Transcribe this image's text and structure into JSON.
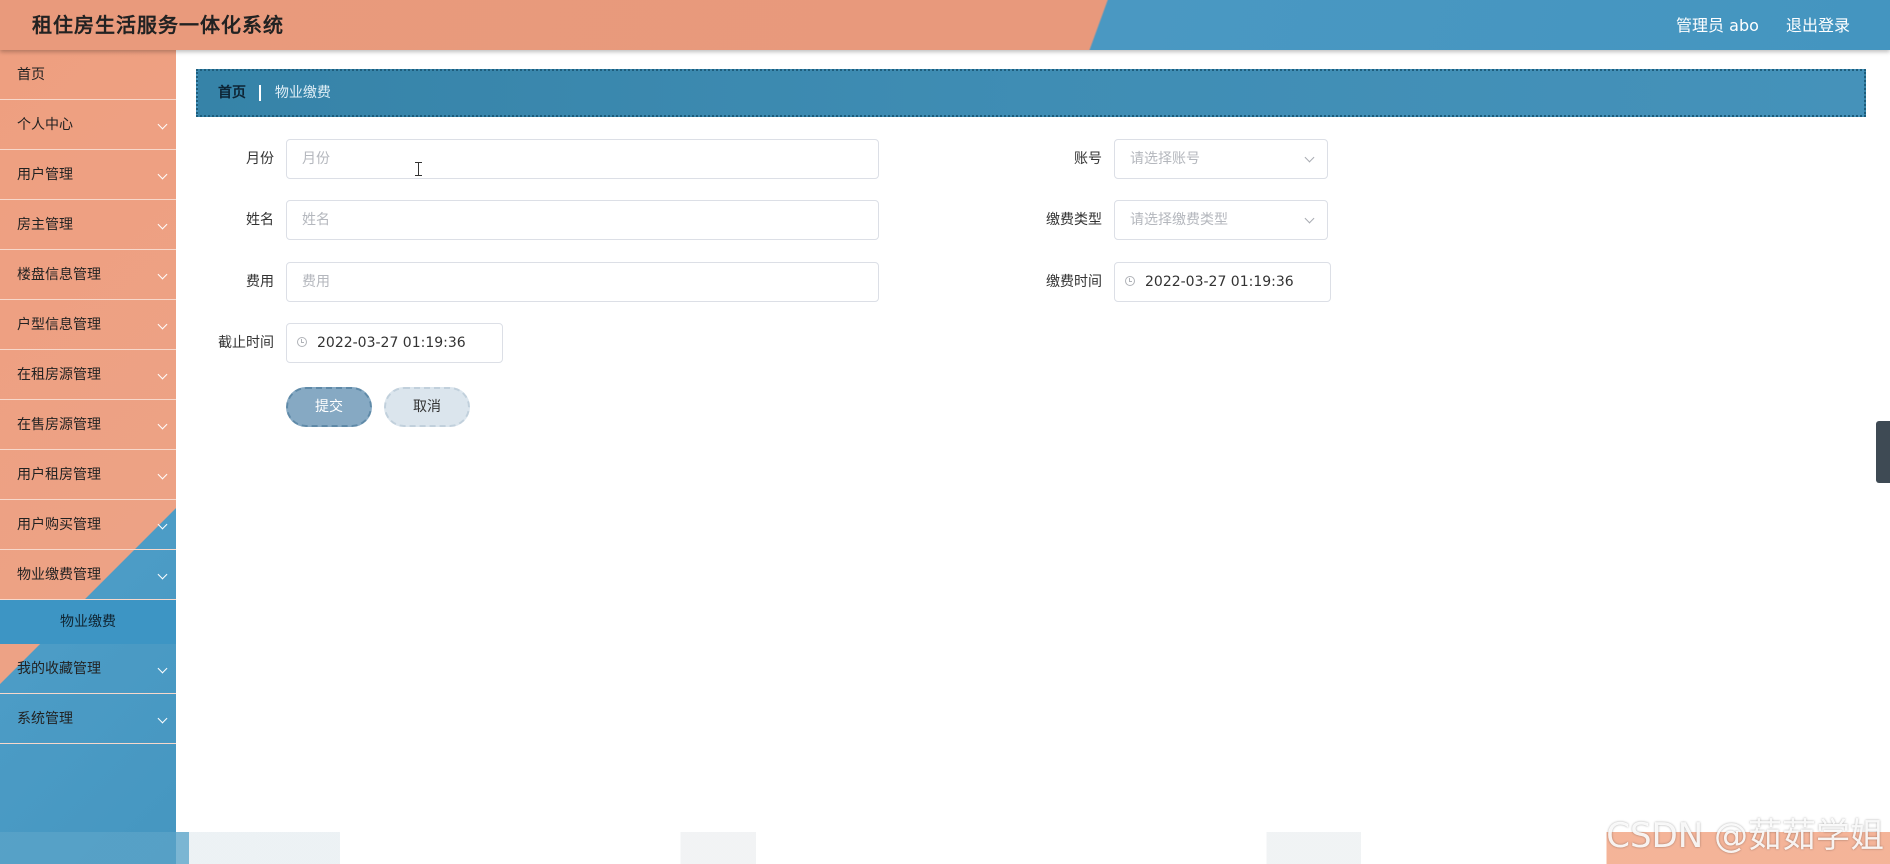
{
  "header": {
    "title": "租住房生活服务一体化系统",
    "user": "管理员 abo",
    "logout": "退出登录"
  },
  "sidebar": {
    "items": [
      {
        "label": "首页",
        "has_children": false
      },
      {
        "label": "个人中心",
        "has_children": true
      },
      {
        "label": "用户管理",
        "has_children": true
      },
      {
        "label": "房主管理",
        "has_children": true
      },
      {
        "label": "楼盘信息管理",
        "has_children": true
      },
      {
        "label": "户型信息管理",
        "has_children": true
      },
      {
        "label": "在租房源管理",
        "has_children": true
      },
      {
        "label": "在售房源管理",
        "has_children": true
      },
      {
        "label": "用户租房管理",
        "has_children": true
      },
      {
        "label": "用户购买管理",
        "has_children": true
      },
      {
        "label": "物业缴费管理",
        "has_children": true
      },
      {
        "label": "我的收藏管理",
        "has_children": true
      },
      {
        "label": "系统管理",
        "has_children": true
      }
    ],
    "active_submenu": "物业缴费"
  },
  "breadcrumb": {
    "home": "首页",
    "current": "物业缴费"
  },
  "form": {
    "month": {
      "label": "月份",
      "placeholder": "月份"
    },
    "account": {
      "label": "账号",
      "placeholder": "请选择账号"
    },
    "name": {
      "label": "姓名",
      "placeholder": "姓名"
    },
    "fee_type": {
      "label": "缴费类型",
      "placeholder": "请选择缴费类型"
    },
    "fee": {
      "label": "费用",
      "placeholder": "费用"
    },
    "pay_time": {
      "label": "缴费时间",
      "value": "2022-03-27 01:19:36"
    },
    "deadline": {
      "label": "截止时间",
      "value": "2022-03-27 01:19:36"
    },
    "submit": "提交",
    "cancel": "取消"
  },
  "watermark": "CSDN @茹茹学姐",
  "colors": {
    "header_orange": "#e99a7c",
    "header_blue": "#4495c0",
    "active_menu": "#3d95c4"
  }
}
